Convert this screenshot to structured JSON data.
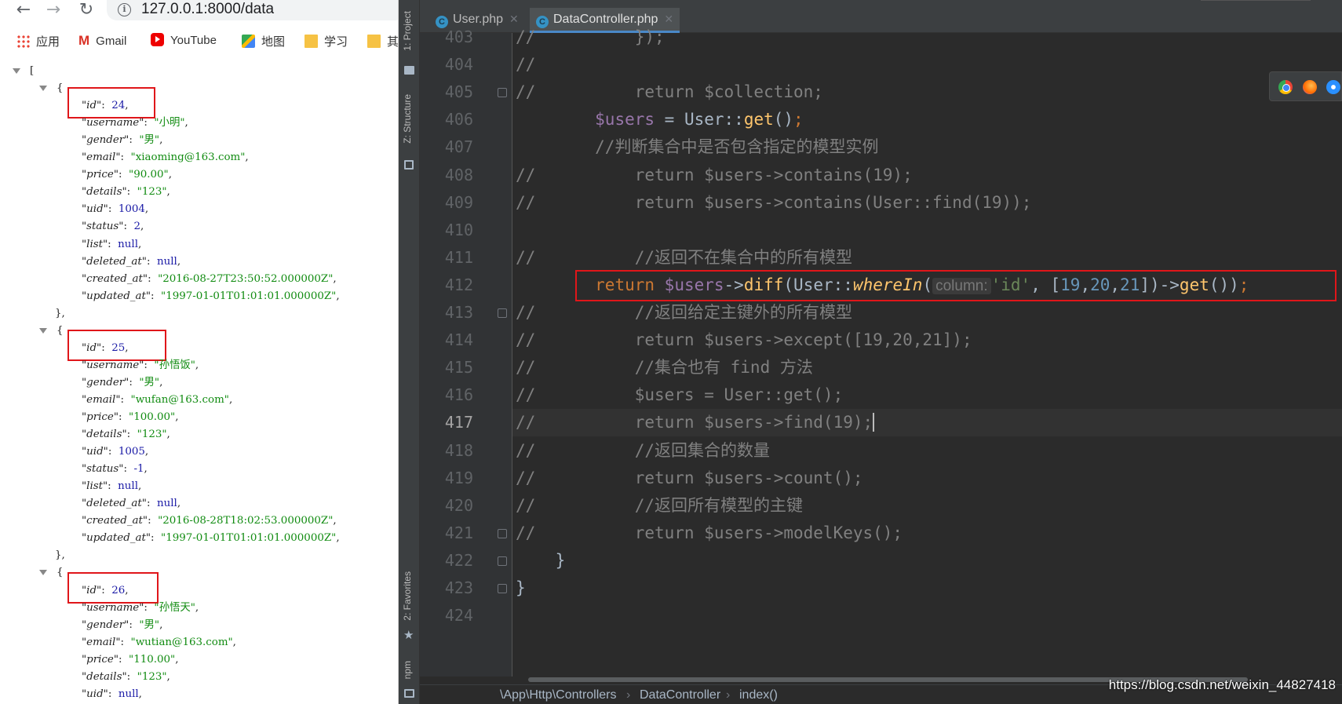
{
  "browser": {
    "url": "127.0.0.1:8000/data",
    "nav": {
      "back": "←",
      "forward": "→",
      "reload": "↻"
    },
    "bookmarks": [
      {
        "label": "应用",
        "icon": "apps-grid-icon"
      },
      {
        "label": "Gmail",
        "icon": "gmail-icon"
      },
      {
        "label": "YouTube",
        "icon": "youtube-icon"
      },
      {
        "label": "地图",
        "icon": "maps-icon"
      },
      {
        "label": "学习",
        "icon": "folder-icon"
      },
      {
        "label": "其",
        "icon": "folder-icon"
      }
    ],
    "json_viewer": {
      "open_bracket": "[",
      "records": [
        {
          "id": 24,
          "username": "小明",
          "gender": "男",
          "email": "xiaoming@163.com",
          "price": "90.00",
          "details": "123",
          "uid": 1004,
          "status": 2,
          "list": null,
          "deleted_at": null,
          "created_at": "2016-08-27T23:50:52.000000Z",
          "updated_at": "1997-01-01T01:01:01.000000Z"
        },
        {
          "id": 25,
          "username": "孙悟饭",
          "gender": "男",
          "email": "wufan@163.com",
          "price": "100.00",
          "details": "123",
          "uid": 1005,
          "status": -1,
          "list": null,
          "deleted_at": null,
          "created_at": "2016-08-28T18:02:53.000000Z",
          "updated_at": "1997-01-01T01:01:01.000000Z"
        },
        {
          "id": 26,
          "username": "孙悟天",
          "gender": "男",
          "email": "wutian@163.com",
          "price": "110.00",
          "details": "123",
          "uid": null
        }
      ]
    }
  },
  "ide": {
    "tabs": [
      {
        "label": "User.php",
        "active": false
      },
      {
        "label": "DataController.php",
        "active": true
      }
    ],
    "side_tabs": [
      "1: Project",
      "Z: Structure",
      "2: Favorites",
      "npm"
    ],
    "code_lines": [
      {
        "n": "403",
        "text": "//          });"
      },
      {
        "n": "404",
        "text": "//"
      },
      {
        "n": "405",
        "text": "//          return $collection;"
      },
      {
        "n": "406",
        "text": "        $users = User::get();"
      },
      {
        "n": "407",
        "text": "        //判断集合中是否包含指定的模型实例"
      },
      {
        "n": "408",
        "text": "//          return $users->contains(19);"
      },
      {
        "n": "409",
        "text": "//          return $users->contains(User::find(19));"
      },
      {
        "n": "410",
        "text": ""
      },
      {
        "n": "411",
        "text": "//          //返回不在集合中的所有模型"
      },
      {
        "n": "412",
        "text": "        return $users->diff(User::whereIn( column: 'id', [19,20,21])->get());"
      },
      {
        "n": "413",
        "text": "//          //返回给定主键外的所有模型"
      },
      {
        "n": "414",
        "text": "//          return $users->except([19,20,21]);"
      },
      {
        "n": "415",
        "text": "//          //集合也有 find 方法"
      },
      {
        "n": "416",
        "text": "//          $users = User::get();"
      },
      {
        "n": "417",
        "text": "//          return $users->find(19);"
      },
      {
        "n": "418",
        "text": "//          //返回集合的数量"
      },
      {
        "n": "419",
        "text": "//          return $users->count();"
      },
      {
        "n": "420",
        "text": "//          //返回所有模型的主键"
      },
      {
        "n": "421",
        "text": "//          return $users->modelKeys();"
      },
      {
        "n": "422",
        "text": "    }"
      },
      {
        "n": "423",
        "text": "}"
      },
      {
        "n": "424",
        "text": ""
      }
    ],
    "current_line": "417",
    "param_hint": "column:",
    "breadcrumb": [
      "\\App\\Http\\Controllers",
      "DataController",
      "index()"
    ],
    "breadcrumb_sep": "›",
    "browser_icons": [
      "chrome-icon",
      "firefox-icon",
      "safari-icon"
    ]
  },
  "watermark": "https://blog.csdn.net/weixin_44827418",
  "colors": {
    "highlight_box": "#e0161a",
    "editor_bg": "#2b2b2b",
    "keyword": "#cc7832",
    "variable": "#9876aa",
    "function": "#ffc66d",
    "string": "#6a8759",
    "number": "#6897bb",
    "comment": "#808080"
  }
}
